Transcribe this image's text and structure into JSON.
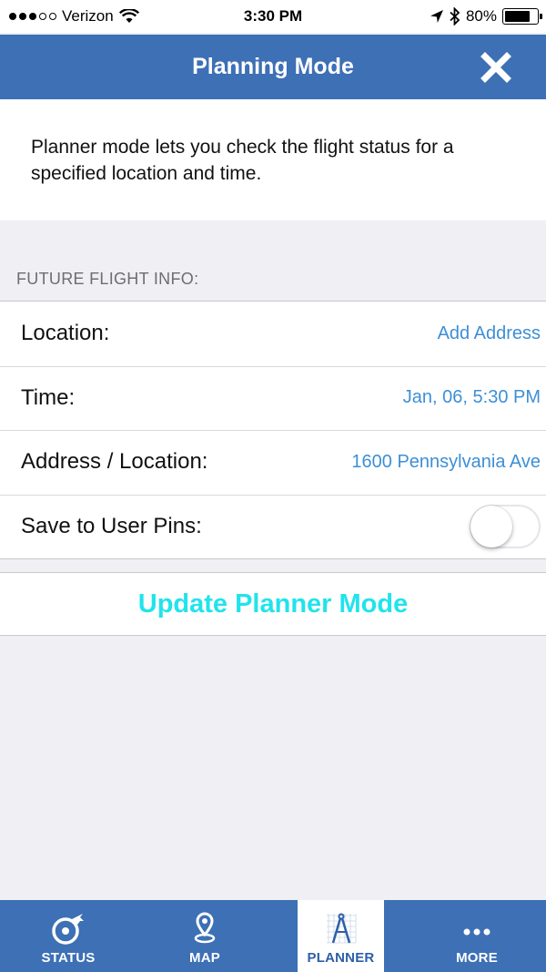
{
  "status_bar": {
    "carrier": "Verizon",
    "time": "3:30 PM",
    "battery": "80%",
    "battery_level": 0.8
  },
  "nav": {
    "title": "Planning Mode",
    "close_icon": "close-x-icon"
  },
  "intro": {
    "text": "Planner mode lets you check the flight status for a specified location and time."
  },
  "section": {
    "header": "FUTURE FLIGHT INFO:"
  },
  "rows": [
    {
      "label": "Location:",
      "value": "Add Address"
    },
    {
      "label": "Time:",
      "value": "Jan, 06, 5:30 PM"
    },
    {
      "label": "Address / Location:",
      "value": "1600 Pennsylvania Ave"
    },
    {
      "label": "Save to User Pins:",
      "toggle_on": false
    }
  ],
  "update_button": {
    "label": "Update Planner Mode"
  },
  "tabs": [
    {
      "label": "STATUS",
      "icon": "status-plane-icon",
      "active": false
    },
    {
      "label": "MAP",
      "icon": "map-pin-icon",
      "active": false
    },
    {
      "label": "PLANNER",
      "icon": "planner-compass-icon",
      "active": true
    },
    {
      "label": "MORE",
      "icon": "more-dots-icon",
      "active": false
    }
  ],
  "colors": {
    "nav_blue": "#3d70b5",
    "link_blue": "#3d8fd6",
    "update_cyan": "#22e3ec",
    "background": "#efeff4"
  }
}
